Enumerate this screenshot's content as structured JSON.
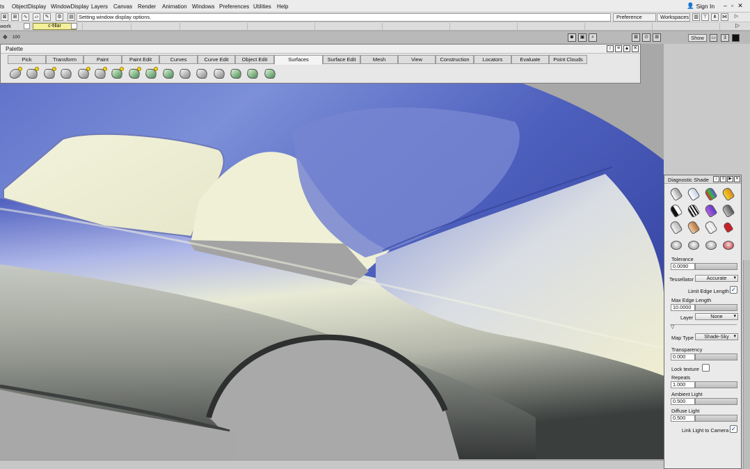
{
  "menubar": {
    "items": [
      "ts",
      "ObjectDisplay",
      "WindowDisplay",
      "Layers",
      "Canvas",
      "Render",
      "Animation",
      "Windows",
      "Preferences",
      "Utilities",
      "Help"
    ],
    "signin": "Sign In"
  },
  "toolbar": {
    "status_message": "Setting window display options.",
    "preference_sets": "Preference Sets",
    "workspaces": "Workspaces"
  },
  "layers": {
    "work": "work",
    "active_layer": "c-fillar"
  },
  "viewstrip": {
    "zoom_text": "100",
    "show_button": "Show",
    "count": "3"
  },
  "palette": {
    "title": "Palette",
    "tabs": [
      "Pick",
      "Transform",
      "Paint",
      "Paint Edit",
      "Curves",
      "Curve Edit",
      "Object Edit",
      "Surfaces",
      "Surface Edit",
      "Mesh",
      "View",
      "Construction",
      "Locators",
      "Evaluate",
      "Point Clouds"
    ],
    "active_tab": "Surfaces",
    "surface_tools": [
      "primitive-sphere-icon",
      "revolve-icon",
      "skin-icon",
      "rail-surface-icon",
      "set-planar-icon",
      "boundary-icon",
      "square-icon",
      "msdrape-icon",
      "extrude-icon",
      "tube-flange-icon",
      "ruled-surface-icon",
      "draft-icon",
      "panel-gap-icon",
      "offset-icon",
      "freeform-fillet-icon",
      "surface-fillet-icon"
    ]
  },
  "diagnostic": {
    "title": "Diagnostic Shade",
    "shaders": [
      "shaded-icon",
      "multi-color-icon",
      "curvature-icon",
      "gaussian-icon",
      "isophote-icon",
      "zebra-icon",
      "horizontal-icon",
      "surface-normal-icon",
      "ref-map-icon",
      "wood-icon",
      "texture-icon",
      "clear-icon",
      "display-off-1-icon",
      "display-off-2-icon",
      "display-off-3-icon",
      "display-refresh-icon"
    ],
    "tolerance_label": "Tolerance",
    "tolerance_value": "0.0090",
    "tessellator_label": "Tessellator",
    "tessellator_value": "Accurate",
    "limit_edge_label": "Limit Edge Length",
    "limit_edge_checked": "✓",
    "max_edge_label": "Max Edge Length",
    "max_edge_value": "10.0000",
    "layer_label": "Layer",
    "layer_value": "None",
    "map_type_label": "Map Type",
    "map_type_value": "Shade-Sky",
    "transparency_label": "Transparency",
    "transparency_value": "0.000",
    "lock_texture_label": "Lock texture",
    "repeats_label": "Repeats",
    "repeats_value": "1.000",
    "ambient_label": "Ambient Light",
    "ambient_value": "0.500",
    "diffuse_label": "Diffuse Light",
    "diffuse_value": "0.500",
    "link_light_label": "Link Light to Camera",
    "link_light_checked": "✓"
  },
  "colors": {
    "surface_blue": "#5f72c8",
    "surface_cream": "#eeeed3",
    "surface_dark": "#3a3d3c",
    "background_gray": "#a8a8a8",
    "active_layer_yellow": "#f5f09a"
  }
}
